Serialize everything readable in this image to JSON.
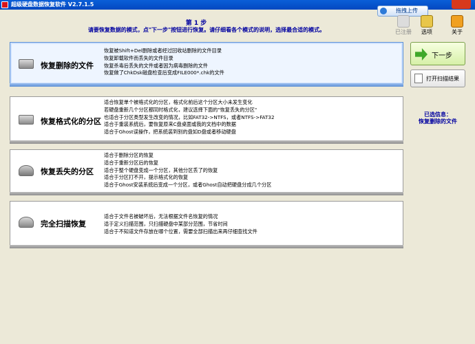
{
  "window": {
    "title": "超级硬盘数据恢复软件 V2.7.1.5",
    "upload_label": "拖拽上传"
  },
  "toolbar": {
    "register_label": "已注册",
    "options_label": "选项",
    "about_label": "关于"
  },
  "step": {
    "title": "第 1 步",
    "description": "请要恢复数据的模式，点\"下一步\"按钮进行恢复。请仔细看各个模式的说明，选择最合适的模式。"
  },
  "options": [
    {
      "name": "恢复删除的文件",
      "icon": "hard-drive-icon",
      "selected": true,
      "lines": [
        "恢复被Shift+Del删除或者经过回收站删除的文件目录",
        "恢复卸载软件而丢失的文件目录",
        "恢复杀毒后丢失的文件或者因为病毒删除的文件",
        "恢复做了ChkDsk磁盘检查后变成FILE000*.chk的文件"
      ]
    },
    {
      "name": "恢复格式化的分区",
      "icon": "hard-drive-icon",
      "selected": false,
      "lines": [
        "适合恢复单个被格式化的分区，格式化前后这个分区大小未发生变化",
        "若硬盘重新几个分区都同时格式化，建议选择下面的\"恢复丢失的分区\"",
        "也适合于分区类型发生改变的情况，比如FAT32->NTFS，或者NTFS->FAT32",
        "适合于重装系统后，要恢复原来C盘桌面或我的文档中的数据",
        "适合于Ghost误操作，把系统装到别的盘如D盘或者移动硬盘"
      ]
    },
    {
      "name": "恢复丢失的分区",
      "icon": "disk-search-icon",
      "selected": false,
      "lines": [
        "适合于删除分区的恢复",
        "适合于重新分区后的恢复",
        "适合于整个硬盘变成一个分区，其他分区丢了的恢复",
        "适合于分区打不开，提示格式化的恢复",
        "适合于Ghost安装系统后变成一个分区，或者Ghost自动把硬盘分成几个分区"
      ]
    },
    {
      "name": "完全扫描恢复",
      "icon": "disk-scan-icon",
      "selected": false,
      "lines": [
        "适合于文件名被破坏后，无法根据文件名恢复的情况",
        "适于定义扫描范围，只扫描硬盘中某部分范围，节省时间",
        "适合于不知道文件存放在哪个位置，需要全部扫描出来再仔细查找文件"
      ]
    }
  ],
  "side": {
    "next_label": "下一步",
    "open_scan_label": "打开扫描结果",
    "selected_info_label": "已选信息：",
    "selected_info_value": "恢复删除的文件"
  },
  "colors": {
    "background": "#ece9d8",
    "title_text": "#0000a0",
    "selected_border": "#5a8fd6",
    "titlebar": "#0a5fd8"
  }
}
